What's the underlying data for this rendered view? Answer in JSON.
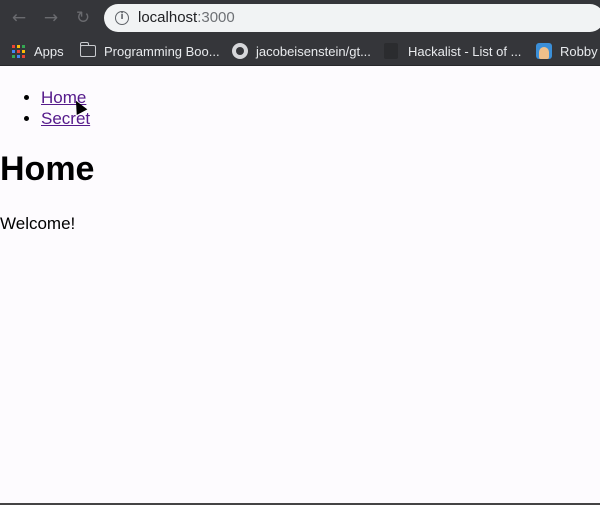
{
  "browser": {
    "url_host": "localhost",
    "url_port": ":3000"
  },
  "bookmarks": [
    {
      "label": "Apps",
      "icon": "apps-grid-icon"
    },
    {
      "label": "Programming Boo...",
      "icon": "folder-icon"
    },
    {
      "label": "jacobeisenstein/gt...",
      "icon": "github-icon"
    },
    {
      "label": "Hackalist - List of ...",
      "icon": "hackalist-icon"
    },
    {
      "label": "Robby R",
      "icon": "avatar-icon"
    }
  ],
  "page": {
    "nav_links": [
      {
        "label": "Home"
      },
      {
        "label": "Secret"
      }
    ],
    "heading": "Home",
    "message": "Welcome!"
  },
  "colors": {
    "toolbar": "#35363a",
    "omnibox": "#f1f3f4",
    "link": "#551a8b",
    "page_bg": "#fdfbfe"
  }
}
